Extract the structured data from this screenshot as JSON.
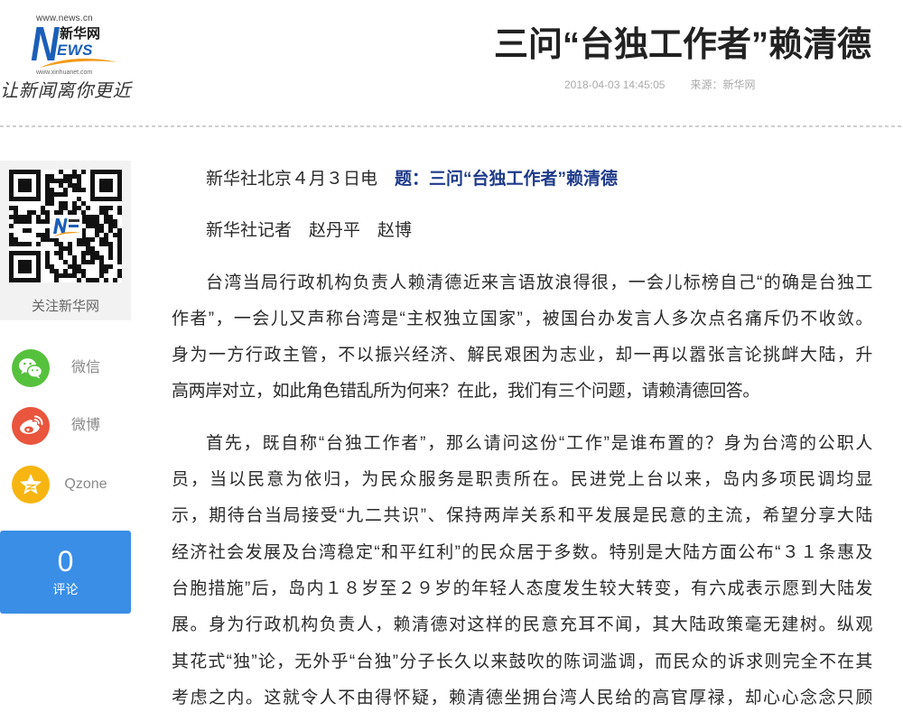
{
  "logo": {
    "url_top": "www.news.cn",
    "letter_n": "N",
    "name_cn": "新华网",
    "letters_ews": "EWS",
    "url_bottom": "www.xinhuanet.com",
    "slogan": "让新闻离你更近"
  },
  "article": {
    "title": "三问“台独工作者”赖清德",
    "datetime": "2018-04-03 14:45:05",
    "source": "来源：新华网",
    "dateline": "新华社北京４月３日电",
    "headline_label": "题：三问“台独工作者”赖清德",
    "byline": "新华社记者　赵丹平　赵博",
    "paragraphs": [
      {
        "lines": [
          "台湾当局行政机构负责人赖清德近来言语放浪得很，一会儿标榜自己“的确是台独工",
          "作者”，一会儿又声称台湾是“主权独立国家”，被国台办发言人多次点名痛斥仍不收敛。",
          "身为一方行政主管，不以振兴经济、解民艰困为志业，却一再以嚣张言论挑衅大陆，升",
          "高两岸对立，如此角色错乱所为何来？在此，我们有三个问题，请赖清德回答。"
        ]
      },
      {
        "lines": [
          "首先，既自称“台独工作者”，那么请问这份“工作”是谁布置的？身为台湾的公职人",
          "员，当以民意为依归，为民众服务是职责所在。民进党上台以来，岛内多项民调均显",
          "示，期待台当局接受“九二共识”、保持两岸关系和平发展是民意的主流，希望分享大陆",
          "经济社会发展及台湾稳定“和平红利”的民众居于多数。特别是大陆方面公布“３１条惠及",
          "台胞措施”后，岛内１８岁至２９岁的年轻人态度发生较大转变，有六成表示愿到大陆发",
          "展。身为行政机构负责人，赖清德对这样的民意充耳不闻，其大陆政策毫无建树。纵观",
          "其花式“独”论，无外乎“台独”分子长久以来鼓吹的陈词滥调，而民众的诉求则完全不在其",
          "考虑之内。这就令人不由得怀疑，赖清德坐拥台湾人民给的高官厚禄，却心心念念只顾"
        ]
      }
    ]
  },
  "sidebar": {
    "qr_caption": "关注新华网",
    "share": [
      {
        "label": "微信",
        "icon": "wechat-icon",
        "color": "#56c13d"
      },
      {
        "label": "微博",
        "icon": "weibo-icon",
        "color": "#e9553d"
      },
      {
        "label": "Qzone",
        "icon": "qzone-icon",
        "color": "#f6b511"
      }
    ],
    "comments": {
      "count": 0,
      "label": "评论"
    }
  },
  "colors": {
    "brand_blue": "#1b5fb8",
    "brand_orange": "#f29b1d",
    "headline_blue": "#1e3a8a",
    "comment_blue": "#3a8ee6",
    "title_text": "#222222",
    "body_text": "#2b2b2b",
    "meta_text": "#aaaaaa"
  }
}
